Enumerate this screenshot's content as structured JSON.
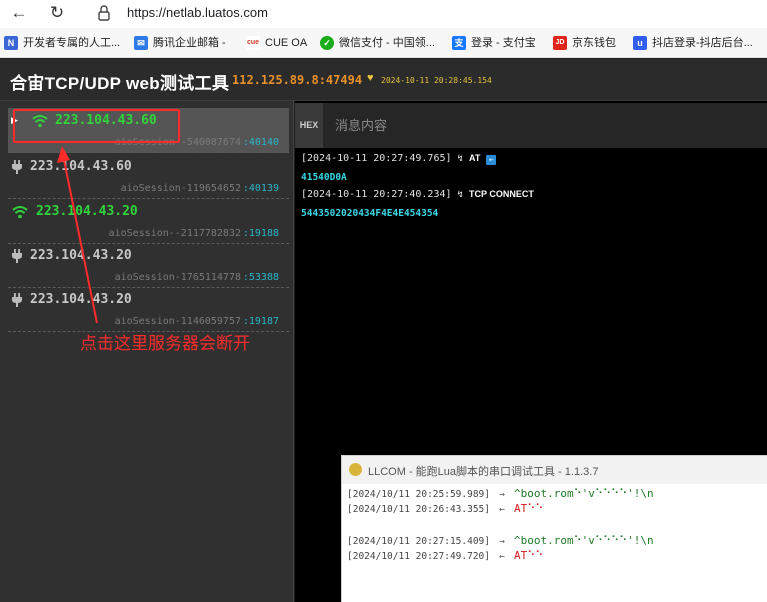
{
  "browser": {
    "url": "https://netlab.luatos.com",
    "bookmarks": [
      {
        "label": "开发者专属的人工...",
        "icon": "ai-icon",
        "color": "#3a66d6"
      },
      {
        "label": "腾讯企业邮箱 -",
        "icon": "mail-icon",
        "color": "#2f7be6"
      },
      {
        "label": "CUE OA",
        "icon": "cue-icon",
        "color": "#d33a2c"
      },
      {
        "label": "微信支付 - 中国领...",
        "icon": "wechat-pay-icon",
        "color": "#1aad19"
      },
      {
        "label": "登录 - 支付宝",
        "icon": "alipay-icon",
        "color": "#1677ff"
      },
      {
        "label": "京东钱包",
        "icon": "jd-icon",
        "color": "#e1251b"
      },
      {
        "label": "抖店登录-抖店后台...",
        "icon": "doudian-icon",
        "color": "#2f5ef0"
      }
    ]
  },
  "app": {
    "title": "合宙TCP/UDP web测试工具",
    "server": "112.125.89.8:47494",
    "datetime": "2024-10-11 20:28:45.154"
  },
  "sessions": [
    {
      "ip": "223.104.43.60",
      "name": "aioSession--540087674",
      "port": ":40140",
      "connected": true,
      "active": true
    },
    {
      "ip": "223.104.43.60",
      "name": "aioSession-119654652",
      "port": ":40139",
      "connected": false,
      "active": false
    },
    {
      "ip": "223.104.43.20",
      "name": "aioSession--2117782832",
      "port": ":19188",
      "connected": true,
      "active": false
    },
    {
      "ip": "223.104.43.20",
      "name": "aioSession-1765114778",
      "port": ":53388",
      "connected": false,
      "active": false
    },
    {
      "ip": "223.104.43.20",
      "name": "aioSession-1146059757",
      "port": ":19187",
      "connected": false,
      "active": false
    }
  ],
  "annotation": {
    "text": "点击这里服务器会断开"
  },
  "main": {
    "hex_label": "HEX",
    "message_placeholder": "消息内容",
    "logs": [
      {
        "time": "[2024-10-11 20:27:49.765]",
        "tag": "AT",
        "data": "41540D0A"
      },
      {
        "time": "[2024-10-11 20:27:40.234]",
        "tag": "TCP  CONNECT",
        "data": "5443502020434F4E4E454354"
      }
    ]
  },
  "llcom": {
    "title": "LLCOM - 能跑Lua脚本的串口调试工具 - 1.1.3.7",
    "lines": [
      {
        "time": "[2024/10/11 20:25:59.989]",
        "dir": "→",
        "msg": "^boot.rom⠑'v⠑⠑⠑⠑'!\\n",
        "color": "green"
      },
      {
        "time": "[2024/10/11 20:26:43.355]",
        "dir": "←",
        "msg": "AT⠑⠑",
        "color": "red"
      },
      {
        "time": "[2024/10/11 20:27:15.409]",
        "dir": "→",
        "msg": "^boot.rom⠑'v⠑⠑⠑⠑'!\\n",
        "color": "green"
      },
      {
        "time": "[2024/10/11 20:27:49.720]",
        "dir": "←",
        "msg": "AT⠑⠑",
        "color": "red"
      }
    ]
  }
}
